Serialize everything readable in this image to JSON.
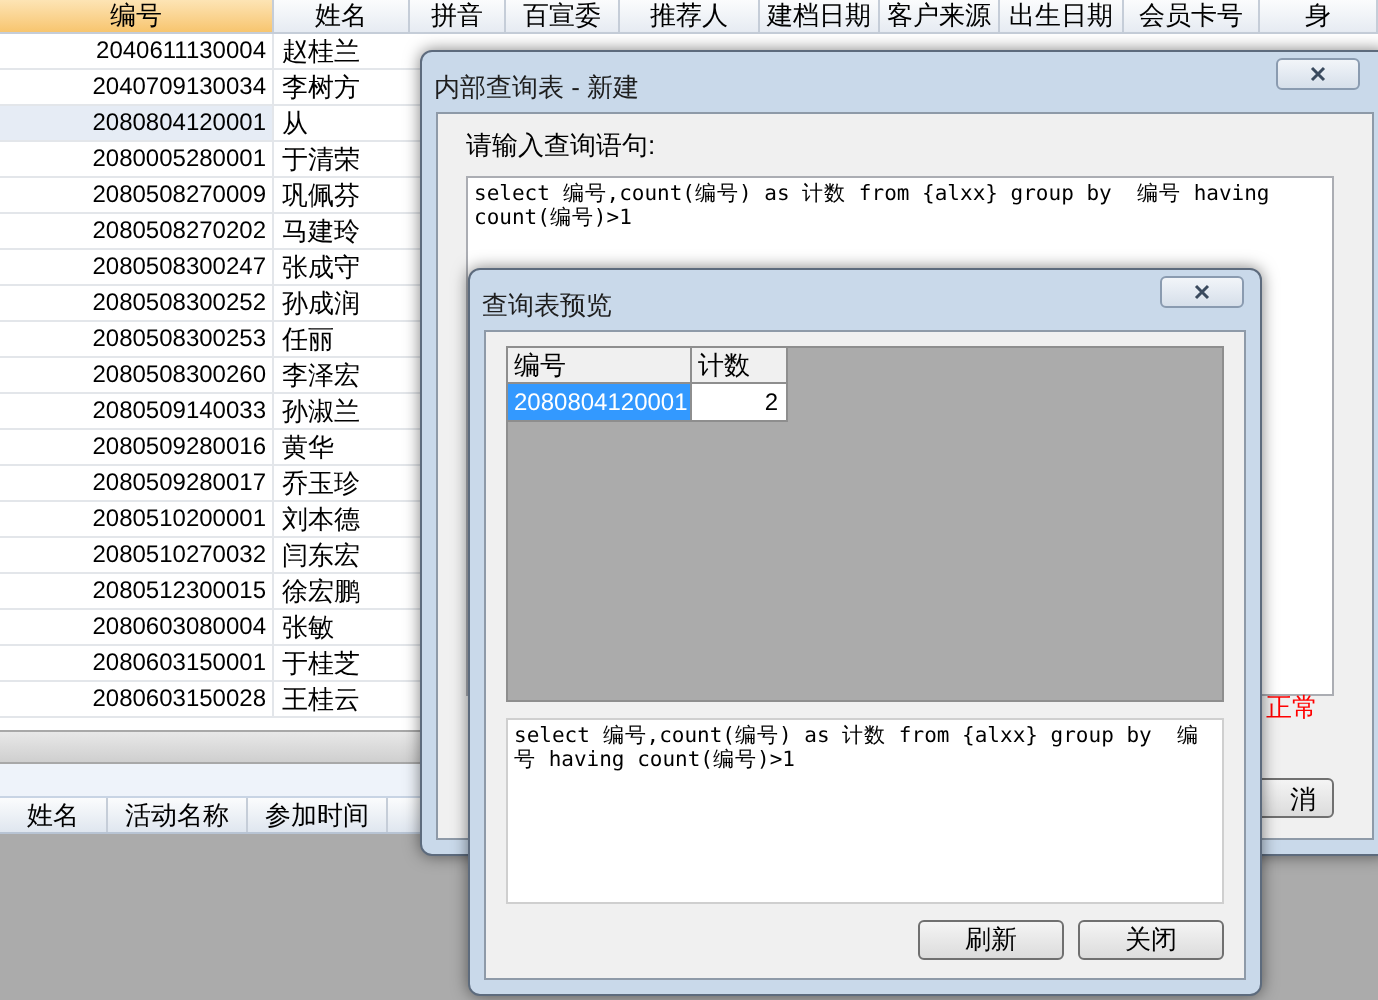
{
  "grid": {
    "columns": [
      {
        "label": "编号",
        "selected": true
      },
      {
        "label": "姓名",
        "selected": false
      },
      {
        "label": "拼音",
        "selected": false
      },
      {
        "label": "百宣委",
        "selected": false
      },
      {
        "label": "推荐人",
        "selected": false
      },
      {
        "label": "建档日期",
        "selected": false
      },
      {
        "label": "客户来源",
        "selected": false
      },
      {
        "label": "出生日期",
        "selected": false
      },
      {
        "label": "会员卡号",
        "selected": false
      },
      {
        "label": "身",
        "selected": false
      }
    ],
    "rows": [
      {
        "id": "2040611130004",
        "name": "赵桂兰",
        "selected": false
      },
      {
        "id": "2040709130034",
        "name": "李树方",
        "selected": false
      },
      {
        "id": "2080804120001",
        "name": "从",
        "selected": true
      },
      {
        "id": "2080005280001",
        "name": "于清荣",
        "selected": false
      },
      {
        "id": "2080508270009",
        "name": "巩佩芬",
        "selected": false
      },
      {
        "id": "2080508270202",
        "name": "马建玲",
        "selected": false
      },
      {
        "id": "2080508300247",
        "name": "张成守",
        "selected": false
      },
      {
        "id": "2080508300252",
        "name": "孙成润",
        "selected": false
      },
      {
        "id": "2080508300253",
        "name": "任丽",
        "selected": false
      },
      {
        "id": "2080508300260",
        "name": "李泽宏",
        "selected": false
      },
      {
        "id": "2080509140033",
        "name": "孙淑兰",
        "selected": false
      },
      {
        "id": "2080509280016",
        "name": "黄华",
        "selected": false
      },
      {
        "id": "2080509280017",
        "name": "乔玉珍",
        "selected": false
      },
      {
        "id": "2080510200001",
        "name": "刘本德",
        "selected": false
      },
      {
        "id": "2080510270032",
        "name": "闫东宏",
        "selected": false
      },
      {
        "id": "2080512300015",
        "name": "徐宏鹏",
        "selected": false
      },
      {
        "id": "2080603080004",
        "name": "张敏",
        "selected": false
      },
      {
        "id": "2080603150001",
        "name": "于桂芝",
        "selected": false
      },
      {
        "id": "2080603150028",
        "name": "王桂云",
        "selected": false
      }
    ]
  },
  "lower_panel": {
    "columns": [
      "姓名",
      "活动名称",
      "参加时间"
    ]
  },
  "query_dialog": {
    "title": "内部查询表 - 新建",
    "prompt": "请输入查询语句:",
    "query": "select 编号,count(编号) as 计数 from {alxx} group by  编号 having count(编号)>1",
    "status": "正常",
    "cancel_button": "消"
  },
  "preview_dialog": {
    "title": "查询表预览",
    "table": {
      "columns": [
        "编号",
        "计数"
      ],
      "rows": [
        {
          "cells": [
            "2080804120001",
            "2"
          ],
          "selected": true
        }
      ]
    },
    "query": "select 编号,count(编号) as 计数 from {alxx} group by  编号 having count(编号)>1",
    "buttons": [
      "刷新",
      "关闭"
    ]
  }
}
